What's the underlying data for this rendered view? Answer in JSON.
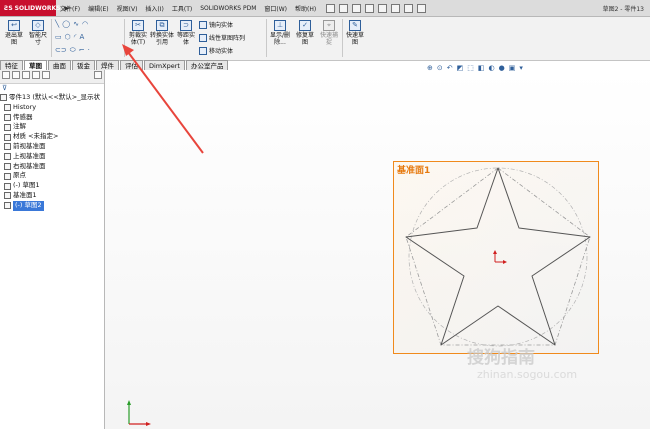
{
  "menubar": {
    "logo": "SOLIDWORKS",
    "menus": [
      "文件(F)",
      "编辑(E)",
      "视图(V)",
      "插入(I)",
      "工具(T)",
      "SOLIDWORKS PDM",
      "窗口(W)",
      "帮助(H)"
    ],
    "title": "草图2 - 零件13"
  },
  "ribbon": {
    "exit_sketch": "退出草图",
    "smart_dim": "智能尺寸",
    "trim": "剪裁实体(T)",
    "convert": "转换实体引用",
    "offset": "等距实体",
    "mirror": "镜向实体",
    "linear_pattern": "线性草图阵列",
    "move": "移动实体",
    "show_delete": "显示/删除...",
    "repair": "修复草图",
    "rapid": "快速捕捉",
    "quick_sketch": "快速草图"
  },
  "tabs": [
    "特征",
    "草图",
    "曲面",
    "钣金",
    "焊件",
    "评估",
    "DimXpert",
    "办公室产品"
  ],
  "active_tab": "草图",
  "tree": {
    "root": "零件13 (默认<<默认>_显示状",
    "items": [
      "History",
      "传感器",
      "注解",
      "材质 <未指定>",
      "前视基准面",
      "上视基准面",
      "右视基准面",
      "原点",
      "(-) 草图1",
      "基准面1",
      "(-) 草图2"
    ]
  },
  "viewport": {
    "plane_label": "基准面1",
    "watermark": "搜狗指南",
    "watermark_url": "zhinan.sogou.com"
  },
  "colors": {
    "accent": "#3a78d8",
    "plane_border": "#f08a1c",
    "logo_bg": "#c8102e",
    "arrow": "#e8453c"
  }
}
